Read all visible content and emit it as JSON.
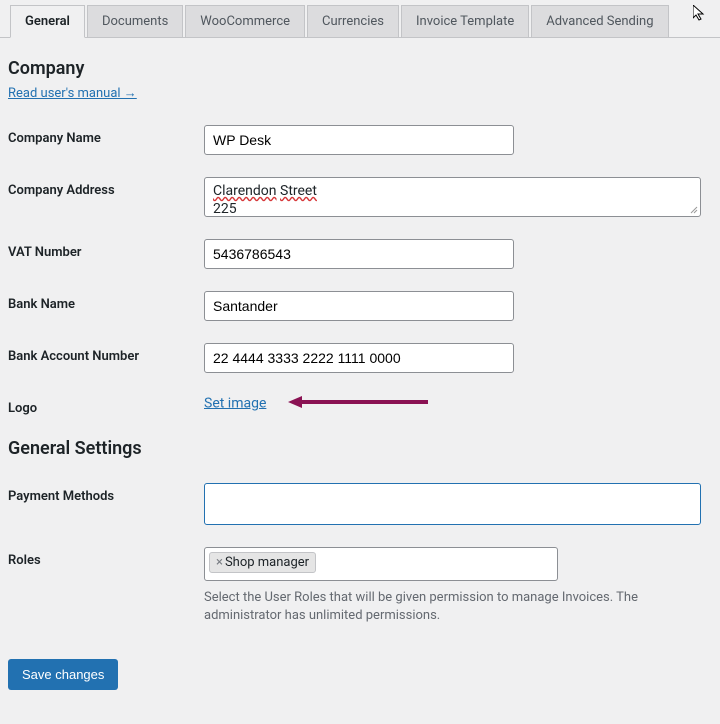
{
  "tabs": {
    "general": "General",
    "documents": "Documents",
    "woocommerce": "WooCommerce",
    "currencies": "Currencies",
    "invoice_template": "Invoice Template",
    "advanced_sending": "Advanced Sending"
  },
  "sections": {
    "company": "Company",
    "general_settings": "General Settings"
  },
  "manual_link": "Read user's manual →",
  "labels": {
    "company_name": "Company Name",
    "company_address": "Company Address",
    "vat_number": "VAT Number",
    "bank_name": "Bank Name",
    "bank_account_number": "Bank Account Number",
    "logo": "Logo",
    "payment_methods": "Payment Methods",
    "roles": "Roles"
  },
  "values": {
    "company_name": "WP Desk",
    "company_address_line1a": "Clarendon",
    "company_address_line1b": "Street",
    "company_address_line2": "225",
    "vat_number": "5436786543",
    "bank_name": "Santander",
    "bank_account_number": "22 4444 3333 2222 1111 0000",
    "payment_methods": ""
  },
  "set_image_label": "Set image",
  "roles_tag": "Shop manager",
  "roles_description": "Select the User Roles that will be given permission to manage Invoices. The administrator has unlimited permissions.",
  "save_button": "Save changes"
}
